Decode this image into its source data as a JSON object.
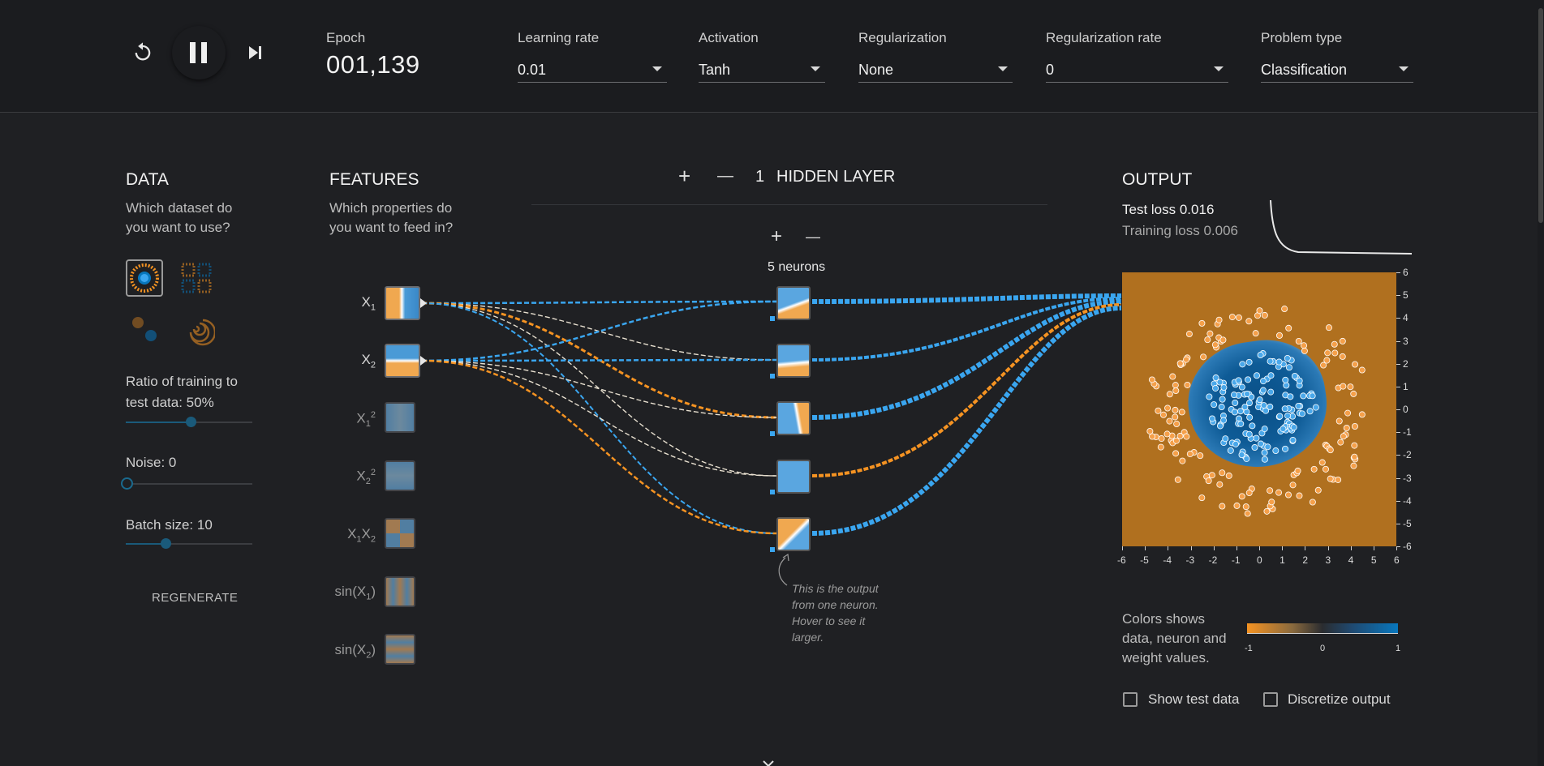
{
  "controls": {
    "reset_icon": "reset-icon",
    "play_pause_icon": "pause-icon",
    "step_icon": "step-forward-icon"
  },
  "epoch": {
    "label": "Epoch",
    "value": "001,139"
  },
  "learning_rate": {
    "label": "Learning rate",
    "value": "0.01"
  },
  "activation": {
    "label": "Activation",
    "value": "Tanh"
  },
  "regularization": {
    "label": "Regularization",
    "value": "None"
  },
  "regularization_rate": {
    "label": "Regularization rate",
    "value": "0"
  },
  "problem_type": {
    "label": "Problem type",
    "value": "Classification"
  },
  "data": {
    "title": "DATA",
    "subtitle_line1": "Which dataset do",
    "subtitle_line2": "you want to use?",
    "ratio_label_line1": "Ratio of training to",
    "ratio_label_line2": "test data:  50%",
    "ratio_value": 0.5,
    "noise_label": "Noise:  0",
    "noise_value": 0,
    "batch_label": "Batch size:  10",
    "batch_value": 0.3,
    "regenerate": "REGENERATE"
  },
  "features": {
    "title": "FEATURES",
    "subtitle_line1": "Which properties do",
    "subtitle_line2": "you want to feed in?",
    "items": [
      {
        "name": "X",
        "sub": "1",
        "sup": "",
        "active": true
      },
      {
        "name": "X",
        "sub": "2",
        "sup": "",
        "active": true
      },
      {
        "name": "X",
        "sub": "1",
        "sup": "2",
        "active": false
      },
      {
        "name": "X",
        "sub": "2",
        "sup": "2",
        "active": false
      },
      {
        "name": "X",
        "sub": "1",
        "sup": "",
        "name2": "X",
        "sub2": "2",
        "active": false
      },
      {
        "name": "sin(X",
        "sub": "1",
        "suffix": ")",
        "active": false
      },
      {
        "name": "sin(X",
        "sub": "2",
        "suffix": ")",
        "active": false
      }
    ]
  },
  "hidden": {
    "plus": "+",
    "minus": "—",
    "count": "1",
    "label": "HIDDEN LAYER",
    "neuron_count_label": "5 neurons",
    "neuron_plus": "+",
    "neuron_minus": "—"
  },
  "note": {
    "line1": "This is the output",
    "line2": "from one neuron.",
    "line3": "Hover to see it",
    "line4": "larger."
  },
  "output": {
    "title": "OUTPUT",
    "test_loss": "Test loss 0.016",
    "training_loss": "Training loss 0.006",
    "y_ticks": [
      "6",
      "5",
      "4",
      "3",
      "2",
      "1",
      "0",
      "-1",
      "-2",
      "-3",
      "-4",
      "-5",
      "-6"
    ],
    "x_ticks": [
      "-6",
      "-5",
      "-4",
      "-3",
      "-2",
      "-1",
      "0",
      "1",
      "2",
      "3",
      "4",
      "5",
      "6"
    ],
    "legend_text_line1": "Colors shows",
    "legend_text_line2": "data, neuron and",
    "legend_text_line3": "weight values.",
    "legend_min": "-1",
    "legend_mid": "0",
    "legend_max": "1",
    "show_test_data": "Show test data",
    "discretize_output": "Discretize output"
  },
  "colors": {
    "orange": "#f59322",
    "blue": "#0877bd",
    "light_blue": "#3aa6f0",
    "bg": "#1f2023"
  }
}
